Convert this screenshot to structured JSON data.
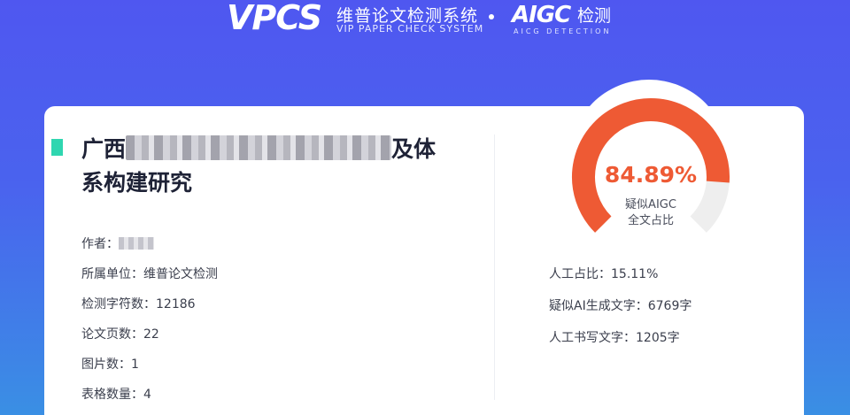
{
  "header": {
    "logo_text": "VPCS",
    "system_name": "维普论文检测系统",
    "system_subtitle": "VIP PAPER CHECK SYSTEM",
    "aigc_logo": "AIGC",
    "aigc_name": "检测",
    "aigc_subtitle": "AICG DETECTION"
  },
  "report": {
    "title_prefix": "广西",
    "title_suffix": "及体",
    "title_line2": "系构建研究",
    "author_label": "作者：",
    "unit_label": "所属单位：",
    "unit_value": "维普论文检测",
    "chars_label": "检测字符数：",
    "chars_value": "12186",
    "pages_label": "论文页数：",
    "pages_value": "22",
    "images_label": "图片数：",
    "images_value": "1",
    "tables_label": "表格数量：",
    "tables_value": "4"
  },
  "gauge": {
    "percent_text": "84.89%",
    "percent_value": 84.89,
    "label_line1": "疑似AIGC",
    "label_line2": "全文占比",
    "colors": {
      "fill": "#ee5a34",
      "track": "#eeeeee"
    }
  },
  "stats": {
    "human_ratio_label": "人工占比：",
    "human_ratio_value": "15.11%",
    "ai_chars_label": "疑似AI生成文字：",
    "ai_chars_value": "6769字",
    "human_chars_label": "人工书写文字：",
    "human_chars_value": "1205字"
  },
  "colors": {
    "accent": "#2fd6b0",
    "background": "#4f57f0"
  }
}
